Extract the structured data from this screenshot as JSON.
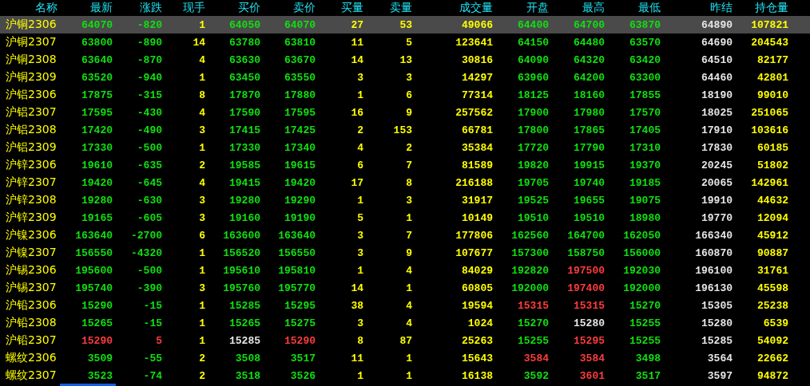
{
  "table": {
    "name_column": "名称",
    "columns": [
      "最新",
      "涨跌",
      "现手",
      "买价",
      "卖价",
      "买量",
      "卖量",
      "成交量",
      "开盘",
      "最高",
      "最低",
      "昨结",
      "持仓量"
    ],
    "rows": [
      {
        "name": "沪铜2306",
        "selected": true,
        "cells": [
          {
            "text": "64070",
            "color": "#10e010"
          },
          {
            "text": "-820",
            "color": "#10e010"
          },
          {
            "text": "1",
            "color": "#ffff00"
          },
          {
            "text": "64050",
            "color": "#10e010"
          },
          {
            "text": "64070",
            "color": "#10e010"
          },
          {
            "text": "27",
            "color": "#ffff00"
          },
          {
            "text": "53",
            "color": "#ffff00"
          },
          {
            "text": "49066",
            "color": "#ffff00"
          },
          {
            "text": "64400",
            "color": "#10e010"
          },
          {
            "text": "64700",
            "color": "#10e010"
          },
          {
            "text": "63870",
            "color": "#10e010"
          },
          {
            "text": "64890",
            "color": "#e6e6e6"
          },
          {
            "text": "107821",
            "color": "#ffff00"
          }
        ]
      },
      {
        "name": "沪铜2307",
        "selected": false,
        "cells": [
          {
            "text": "63800",
            "color": "#10e010"
          },
          {
            "text": "-890",
            "color": "#10e010"
          },
          {
            "text": "14",
            "color": "#ffff00"
          },
          {
            "text": "63780",
            "color": "#10e010"
          },
          {
            "text": "63810",
            "color": "#10e010"
          },
          {
            "text": "11",
            "color": "#ffff00"
          },
          {
            "text": "5",
            "color": "#ffff00"
          },
          {
            "text": "123641",
            "color": "#ffff00"
          },
          {
            "text": "64150",
            "color": "#10e010"
          },
          {
            "text": "64480",
            "color": "#10e010"
          },
          {
            "text": "63570",
            "color": "#10e010"
          },
          {
            "text": "64690",
            "color": "#e6e6e6"
          },
          {
            "text": "204543",
            "color": "#ffff00"
          }
        ]
      },
      {
        "name": "沪铜2308",
        "selected": false,
        "cells": [
          {
            "text": "63640",
            "color": "#10e010"
          },
          {
            "text": "-870",
            "color": "#10e010"
          },
          {
            "text": "4",
            "color": "#ffff00"
          },
          {
            "text": "63630",
            "color": "#10e010"
          },
          {
            "text": "63670",
            "color": "#10e010"
          },
          {
            "text": "14",
            "color": "#ffff00"
          },
          {
            "text": "13",
            "color": "#ffff00"
          },
          {
            "text": "30816",
            "color": "#ffff00"
          },
          {
            "text": "64090",
            "color": "#10e010"
          },
          {
            "text": "64320",
            "color": "#10e010"
          },
          {
            "text": "63420",
            "color": "#10e010"
          },
          {
            "text": "64510",
            "color": "#e6e6e6"
          },
          {
            "text": "82177",
            "color": "#ffff00"
          }
        ]
      },
      {
        "name": "沪铜2309",
        "selected": false,
        "cells": [
          {
            "text": "63520",
            "color": "#10e010"
          },
          {
            "text": "-940",
            "color": "#10e010"
          },
          {
            "text": "1",
            "color": "#ffff00"
          },
          {
            "text": "63450",
            "color": "#10e010"
          },
          {
            "text": "63550",
            "color": "#10e010"
          },
          {
            "text": "3",
            "color": "#ffff00"
          },
          {
            "text": "3",
            "color": "#ffff00"
          },
          {
            "text": "14297",
            "color": "#ffff00"
          },
          {
            "text": "63960",
            "color": "#10e010"
          },
          {
            "text": "64200",
            "color": "#10e010"
          },
          {
            "text": "63300",
            "color": "#10e010"
          },
          {
            "text": "64460",
            "color": "#e6e6e6"
          },
          {
            "text": "42801",
            "color": "#ffff00"
          }
        ]
      },
      {
        "name": "沪铝2306",
        "selected": false,
        "cells": [
          {
            "text": "17875",
            "color": "#10e010"
          },
          {
            "text": "-315",
            "color": "#10e010"
          },
          {
            "text": "8",
            "color": "#ffff00"
          },
          {
            "text": "17870",
            "color": "#10e010"
          },
          {
            "text": "17880",
            "color": "#10e010"
          },
          {
            "text": "1",
            "color": "#ffff00"
          },
          {
            "text": "6",
            "color": "#ffff00"
          },
          {
            "text": "77314",
            "color": "#ffff00"
          },
          {
            "text": "18125",
            "color": "#10e010"
          },
          {
            "text": "18160",
            "color": "#10e010"
          },
          {
            "text": "17855",
            "color": "#10e010"
          },
          {
            "text": "18190",
            "color": "#e6e6e6"
          },
          {
            "text": "99010",
            "color": "#ffff00"
          }
        ]
      },
      {
        "name": "沪铝2307",
        "selected": false,
        "cells": [
          {
            "text": "17595",
            "color": "#10e010"
          },
          {
            "text": "-430",
            "color": "#10e010"
          },
          {
            "text": "4",
            "color": "#ffff00"
          },
          {
            "text": "17590",
            "color": "#10e010"
          },
          {
            "text": "17595",
            "color": "#10e010"
          },
          {
            "text": "16",
            "color": "#ffff00"
          },
          {
            "text": "9",
            "color": "#ffff00"
          },
          {
            "text": "257562",
            "color": "#ffff00"
          },
          {
            "text": "17900",
            "color": "#10e010"
          },
          {
            "text": "17980",
            "color": "#10e010"
          },
          {
            "text": "17570",
            "color": "#10e010"
          },
          {
            "text": "18025",
            "color": "#e6e6e6"
          },
          {
            "text": "251065",
            "color": "#ffff00"
          }
        ]
      },
      {
        "name": "沪铝2308",
        "selected": false,
        "cells": [
          {
            "text": "17420",
            "color": "#10e010"
          },
          {
            "text": "-490",
            "color": "#10e010"
          },
          {
            "text": "3",
            "color": "#ffff00"
          },
          {
            "text": "17415",
            "color": "#10e010"
          },
          {
            "text": "17425",
            "color": "#10e010"
          },
          {
            "text": "2",
            "color": "#ffff00"
          },
          {
            "text": "153",
            "color": "#ffff00"
          },
          {
            "text": "66781",
            "color": "#ffff00"
          },
          {
            "text": "17800",
            "color": "#10e010"
          },
          {
            "text": "17865",
            "color": "#10e010"
          },
          {
            "text": "17405",
            "color": "#10e010"
          },
          {
            "text": "17910",
            "color": "#e6e6e6"
          },
          {
            "text": "103616",
            "color": "#ffff00"
          }
        ]
      },
      {
        "name": "沪铝2309",
        "selected": false,
        "cells": [
          {
            "text": "17330",
            "color": "#10e010"
          },
          {
            "text": "-500",
            "color": "#10e010"
          },
          {
            "text": "1",
            "color": "#ffff00"
          },
          {
            "text": "17330",
            "color": "#10e010"
          },
          {
            "text": "17340",
            "color": "#10e010"
          },
          {
            "text": "4",
            "color": "#ffff00"
          },
          {
            "text": "2",
            "color": "#ffff00"
          },
          {
            "text": "35384",
            "color": "#ffff00"
          },
          {
            "text": "17720",
            "color": "#10e010"
          },
          {
            "text": "17790",
            "color": "#10e010"
          },
          {
            "text": "17310",
            "color": "#10e010"
          },
          {
            "text": "17830",
            "color": "#e6e6e6"
          },
          {
            "text": "60185",
            "color": "#ffff00"
          }
        ]
      },
      {
        "name": "沪锌2306",
        "selected": false,
        "cells": [
          {
            "text": "19610",
            "color": "#10e010"
          },
          {
            "text": "-635",
            "color": "#10e010"
          },
          {
            "text": "2",
            "color": "#ffff00"
          },
          {
            "text": "19585",
            "color": "#10e010"
          },
          {
            "text": "19615",
            "color": "#10e010"
          },
          {
            "text": "6",
            "color": "#ffff00"
          },
          {
            "text": "7",
            "color": "#ffff00"
          },
          {
            "text": "81589",
            "color": "#ffff00"
          },
          {
            "text": "19820",
            "color": "#10e010"
          },
          {
            "text": "19915",
            "color": "#10e010"
          },
          {
            "text": "19370",
            "color": "#10e010"
          },
          {
            "text": "20245",
            "color": "#e6e6e6"
          },
          {
            "text": "51802",
            "color": "#ffff00"
          }
        ]
      },
      {
        "name": "沪锌2307",
        "selected": false,
        "cells": [
          {
            "text": "19420",
            "color": "#10e010"
          },
          {
            "text": "-645",
            "color": "#10e010"
          },
          {
            "text": "4",
            "color": "#ffff00"
          },
          {
            "text": "19415",
            "color": "#10e010"
          },
          {
            "text": "19420",
            "color": "#10e010"
          },
          {
            "text": "17",
            "color": "#ffff00"
          },
          {
            "text": "8",
            "color": "#ffff00"
          },
          {
            "text": "216188",
            "color": "#ffff00"
          },
          {
            "text": "19705",
            "color": "#10e010"
          },
          {
            "text": "19740",
            "color": "#10e010"
          },
          {
            "text": "19185",
            "color": "#10e010"
          },
          {
            "text": "20065",
            "color": "#e6e6e6"
          },
          {
            "text": "142961",
            "color": "#ffff00"
          }
        ]
      },
      {
        "name": "沪锌2308",
        "selected": false,
        "cells": [
          {
            "text": "19280",
            "color": "#10e010"
          },
          {
            "text": "-630",
            "color": "#10e010"
          },
          {
            "text": "3",
            "color": "#ffff00"
          },
          {
            "text": "19280",
            "color": "#10e010"
          },
          {
            "text": "19290",
            "color": "#10e010"
          },
          {
            "text": "1",
            "color": "#ffff00"
          },
          {
            "text": "3",
            "color": "#ffff00"
          },
          {
            "text": "31917",
            "color": "#ffff00"
          },
          {
            "text": "19525",
            "color": "#10e010"
          },
          {
            "text": "19655",
            "color": "#10e010"
          },
          {
            "text": "19075",
            "color": "#10e010"
          },
          {
            "text": "19910",
            "color": "#e6e6e6"
          },
          {
            "text": "44632",
            "color": "#ffff00"
          }
        ]
      },
      {
        "name": "沪锌2309",
        "selected": false,
        "cells": [
          {
            "text": "19165",
            "color": "#10e010"
          },
          {
            "text": "-605",
            "color": "#10e010"
          },
          {
            "text": "3",
            "color": "#ffff00"
          },
          {
            "text": "19160",
            "color": "#10e010"
          },
          {
            "text": "19190",
            "color": "#10e010"
          },
          {
            "text": "5",
            "color": "#ffff00"
          },
          {
            "text": "1",
            "color": "#ffff00"
          },
          {
            "text": "10149",
            "color": "#ffff00"
          },
          {
            "text": "19510",
            "color": "#10e010"
          },
          {
            "text": "19510",
            "color": "#10e010"
          },
          {
            "text": "18980",
            "color": "#10e010"
          },
          {
            "text": "19770",
            "color": "#e6e6e6"
          },
          {
            "text": "12094",
            "color": "#ffff00"
          }
        ]
      },
      {
        "name": "沪镍2306",
        "selected": false,
        "cells": [
          {
            "text": "163640",
            "color": "#10e010"
          },
          {
            "text": "-2700",
            "color": "#10e010"
          },
          {
            "text": "6",
            "color": "#ffff00"
          },
          {
            "text": "163600",
            "color": "#10e010"
          },
          {
            "text": "163640",
            "color": "#10e010"
          },
          {
            "text": "3",
            "color": "#ffff00"
          },
          {
            "text": "7",
            "color": "#ffff00"
          },
          {
            "text": "177806",
            "color": "#ffff00"
          },
          {
            "text": "162560",
            "color": "#10e010"
          },
          {
            "text": "164700",
            "color": "#10e010"
          },
          {
            "text": "162050",
            "color": "#10e010"
          },
          {
            "text": "166340",
            "color": "#e6e6e6"
          },
          {
            "text": "45912",
            "color": "#ffff00"
          }
        ]
      },
      {
        "name": "沪镍2307",
        "selected": false,
        "cells": [
          {
            "text": "156550",
            "color": "#10e010"
          },
          {
            "text": "-4320",
            "color": "#10e010"
          },
          {
            "text": "1",
            "color": "#ffff00"
          },
          {
            "text": "156520",
            "color": "#10e010"
          },
          {
            "text": "156550",
            "color": "#10e010"
          },
          {
            "text": "3",
            "color": "#ffff00"
          },
          {
            "text": "9",
            "color": "#ffff00"
          },
          {
            "text": "107677",
            "color": "#ffff00"
          },
          {
            "text": "157300",
            "color": "#10e010"
          },
          {
            "text": "158750",
            "color": "#10e010"
          },
          {
            "text": "156000",
            "color": "#10e010"
          },
          {
            "text": "160870",
            "color": "#e6e6e6"
          },
          {
            "text": "90887",
            "color": "#ffff00"
          }
        ]
      },
      {
        "name": "沪锡2306",
        "selected": false,
        "cells": [
          {
            "text": "195600",
            "color": "#10e010"
          },
          {
            "text": "-500",
            "color": "#10e010"
          },
          {
            "text": "1",
            "color": "#ffff00"
          },
          {
            "text": "195610",
            "color": "#10e010"
          },
          {
            "text": "195810",
            "color": "#10e010"
          },
          {
            "text": "1",
            "color": "#ffff00"
          },
          {
            "text": "4",
            "color": "#ffff00"
          },
          {
            "text": "84029",
            "color": "#ffff00"
          },
          {
            "text": "192820",
            "color": "#10e010"
          },
          {
            "text": "197500",
            "color": "#ff3c3c"
          },
          {
            "text": "192030",
            "color": "#10e010"
          },
          {
            "text": "196100",
            "color": "#e6e6e6"
          },
          {
            "text": "31761",
            "color": "#ffff00"
          }
        ]
      },
      {
        "name": "沪锡2307",
        "selected": false,
        "cells": [
          {
            "text": "195740",
            "color": "#10e010"
          },
          {
            "text": "-390",
            "color": "#10e010"
          },
          {
            "text": "3",
            "color": "#ffff00"
          },
          {
            "text": "195760",
            "color": "#10e010"
          },
          {
            "text": "195770",
            "color": "#10e010"
          },
          {
            "text": "14",
            "color": "#ffff00"
          },
          {
            "text": "1",
            "color": "#ffff00"
          },
          {
            "text": "60805",
            "color": "#ffff00"
          },
          {
            "text": "192000",
            "color": "#10e010"
          },
          {
            "text": "197400",
            "color": "#ff3c3c"
          },
          {
            "text": "192000",
            "color": "#10e010"
          },
          {
            "text": "196130",
            "color": "#e6e6e6"
          },
          {
            "text": "45598",
            "color": "#ffff00"
          }
        ]
      },
      {
        "name": "沪铅2306",
        "selected": false,
        "cells": [
          {
            "text": "15290",
            "color": "#10e010"
          },
          {
            "text": "-15",
            "color": "#10e010"
          },
          {
            "text": "1",
            "color": "#ffff00"
          },
          {
            "text": "15285",
            "color": "#10e010"
          },
          {
            "text": "15295",
            "color": "#10e010"
          },
          {
            "text": "38",
            "color": "#ffff00"
          },
          {
            "text": "4",
            "color": "#ffff00"
          },
          {
            "text": "19594",
            "color": "#ffff00"
          },
          {
            "text": "15315",
            "color": "#ff3c3c"
          },
          {
            "text": "15315",
            "color": "#ff3c3c"
          },
          {
            "text": "15270",
            "color": "#10e010"
          },
          {
            "text": "15305",
            "color": "#e6e6e6"
          },
          {
            "text": "25238",
            "color": "#ffff00"
          }
        ]
      },
      {
        "name": "沪铅2308",
        "selected": false,
        "cells": [
          {
            "text": "15265",
            "color": "#10e010"
          },
          {
            "text": "-15",
            "color": "#10e010"
          },
          {
            "text": "1",
            "color": "#ffff00"
          },
          {
            "text": "15265",
            "color": "#10e010"
          },
          {
            "text": "15275",
            "color": "#10e010"
          },
          {
            "text": "3",
            "color": "#ffff00"
          },
          {
            "text": "4",
            "color": "#ffff00"
          },
          {
            "text": "1024",
            "color": "#ffff00"
          },
          {
            "text": "15270",
            "color": "#10e010"
          },
          {
            "text": "15280",
            "color": "#e6e6e6"
          },
          {
            "text": "15255",
            "color": "#10e010"
          },
          {
            "text": "15280",
            "color": "#e6e6e6"
          },
          {
            "text": "6539",
            "color": "#ffff00"
          }
        ]
      },
      {
        "name": "沪铅2307",
        "selected": false,
        "cells": [
          {
            "text": "15290",
            "color": "#ff3c3c"
          },
          {
            "text": "5",
            "color": "#ff3c3c"
          },
          {
            "text": "1",
            "color": "#ffff00"
          },
          {
            "text": "15285",
            "color": "#e6e6e6"
          },
          {
            "text": "15290",
            "color": "#ff3c3c"
          },
          {
            "text": "8",
            "color": "#ffff00"
          },
          {
            "text": "87",
            "color": "#ffff00"
          },
          {
            "text": "25263",
            "color": "#ffff00"
          },
          {
            "text": "15255",
            "color": "#10e010"
          },
          {
            "text": "15295",
            "color": "#ff3c3c"
          },
          {
            "text": "15255",
            "color": "#10e010"
          },
          {
            "text": "15285",
            "color": "#e6e6e6"
          },
          {
            "text": "54092",
            "color": "#ffff00"
          }
        ]
      },
      {
        "name": "螺纹2306",
        "selected": false,
        "cells": [
          {
            "text": "3509",
            "color": "#10e010"
          },
          {
            "text": "-55",
            "color": "#10e010"
          },
          {
            "text": "2",
            "color": "#ffff00"
          },
          {
            "text": "3508",
            "color": "#10e010"
          },
          {
            "text": "3517",
            "color": "#10e010"
          },
          {
            "text": "11",
            "color": "#ffff00"
          },
          {
            "text": "1",
            "color": "#ffff00"
          },
          {
            "text": "15643",
            "color": "#ffff00"
          },
          {
            "text": "3584",
            "color": "#ff3c3c"
          },
          {
            "text": "3584",
            "color": "#ff3c3c"
          },
          {
            "text": "3498",
            "color": "#10e010"
          },
          {
            "text": "3564",
            "color": "#e6e6e6"
          },
          {
            "text": "22662",
            "color": "#ffff00"
          }
        ]
      },
      {
        "name": "螺纹2307",
        "selected": false,
        "cells": [
          {
            "text": "3523",
            "color": "#10e010"
          },
          {
            "text": "-74",
            "color": "#10e010"
          },
          {
            "text": "2",
            "color": "#ffff00"
          },
          {
            "text": "3518",
            "color": "#10e010"
          },
          {
            "text": "3526",
            "color": "#10e010"
          },
          {
            "text": "1",
            "color": "#ffff00"
          },
          {
            "text": "1",
            "color": "#ffff00"
          },
          {
            "text": "16138",
            "color": "#ffff00"
          },
          {
            "text": "3592",
            "color": "#10e010"
          },
          {
            "text": "3601",
            "color": "#ff3c3c"
          },
          {
            "text": "3517",
            "color": "#10e010"
          },
          {
            "text": "3597",
            "color": "#e6e6e6"
          },
          {
            "text": "94872",
            "color": "#ffff00"
          }
        ]
      }
    ]
  }
}
